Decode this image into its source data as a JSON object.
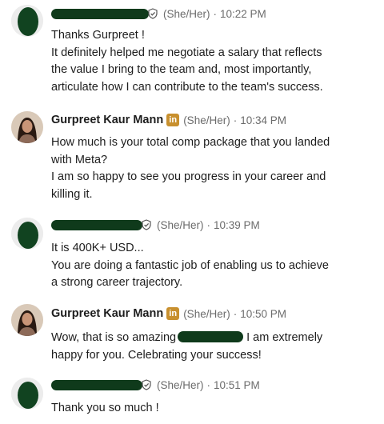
{
  "messages": [
    {
      "sender": "",
      "pronouns": "(She/Her)",
      "separator": "·",
      "time": "10:22 PM",
      "lines": [
        "Thanks Gurpreet !",
        "It definitely helped me negotiate a salary that reflects",
        "the value I bring to the team and, most importantly,",
        "articulate how I can contribute to the team's success."
      ]
    },
    {
      "sender": "Gurpreet Kaur Mann",
      "badge": "in",
      "pronouns": "(She/Her)",
      "separator": "·",
      "time": "10:34 PM",
      "lines": [
        "How much is your total comp package that you landed",
        "with Meta?",
        "I am so happy to see you progress in your career and",
        "killing it."
      ]
    },
    {
      "sender": "",
      "pronouns": "(She/Her)",
      "separator": "·",
      "time": "10:39 PM",
      "lines": [
        "It is 400K+ USD...",
        "You are doing a fantastic job of enabling us to achieve",
        "a strong career trajectory."
      ]
    },
    {
      "sender": "Gurpreet Kaur Mann",
      "badge": "in",
      "pronouns": "(She/Her)",
      "separator": "·",
      "time": "10:50 PM",
      "line1_before": "Wow, that is so amazing",
      "line1_after": "I am extremely",
      "line2": "happy for you. Celebrating your success!"
    },
    {
      "sender": "",
      "pronouns": "(She/Her)",
      "separator": "·",
      "time": "10:51 PM",
      "lines": [
        "Thank you so much !"
      ]
    }
  ],
  "colors": {
    "redaction": "#0f3a1b",
    "badge": "#c8902e",
    "meta_text": "#6b6b6b",
    "body_text": "#1d1d1d"
  },
  "icons": {
    "verified": "shield-check-icon",
    "linkedin": "linkedin-icon"
  }
}
